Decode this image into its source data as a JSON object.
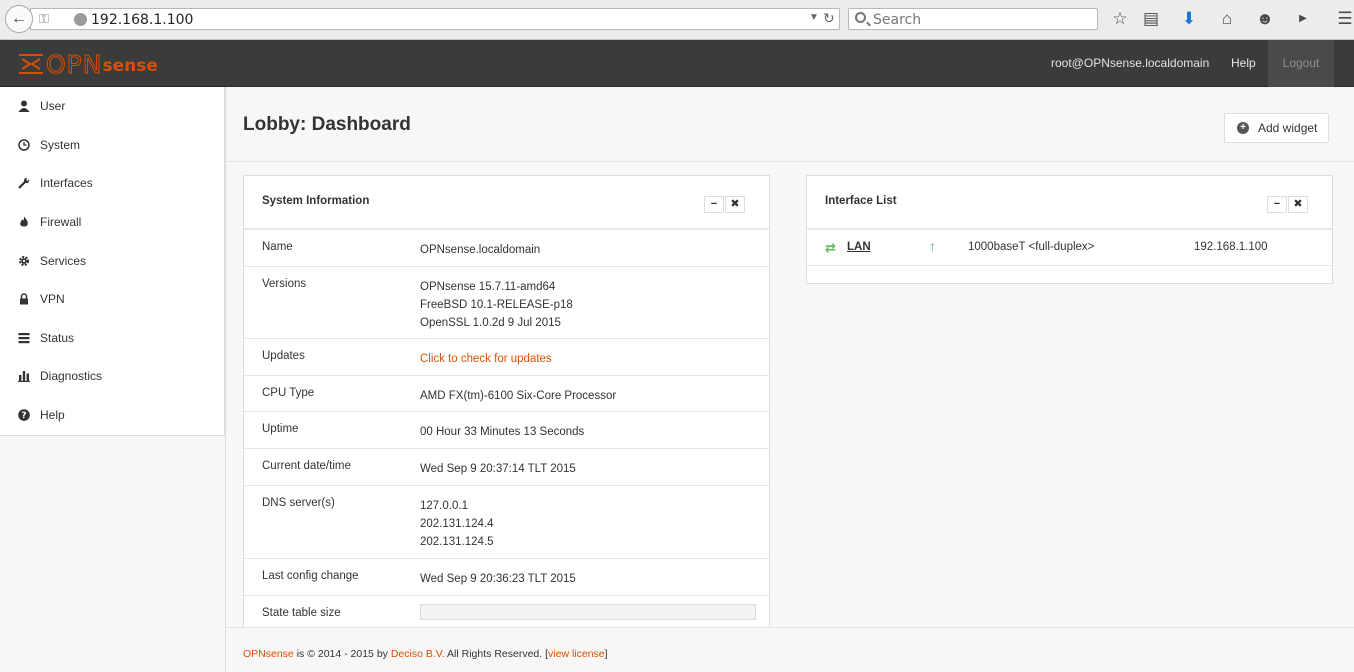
{
  "browser": {
    "url": "192.168.1.100",
    "search_placeholder": "Search"
  },
  "header": {
    "logo_left": "OPN",
    "logo_right": "sense",
    "user": "root@OPNsense.localdomain",
    "help": "Help",
    "logout": "Logout"
  },
  "sidebar": {
    "items": [
      {
        "label": "User",
        "icon": "user-icon"
      },
      {
        "label": "System",
        "icon": "system-icon"
      },
      {
        "label": "Interfaces",
        "icon": "wrench-icon"
      },
      {
        "label": "Firewall",
        "icon": "fire-icon"
      },
      {
        "label": "Services",
        "icon": "gear-icon"
      },
      {
        "label": "VPN",
        "icon": "lock-icon"
      },
      {
        "label": "Status",
        "icon": "tasks-icon"
      },
      {
        "label": "Diagnostics",
        "icon": "bar-chart-icon"
      },
      {
        "label": "Help",
        "icon": "question-icon"
      }
    ]
  },
  "page": {
    "title": "Lobby: Dashboard",
    "add_widget": "Add widget"
  },
  "system_info": {
    "title": "System Information",
    "rows": {
      "name": {
        "label": "Name",
        "value": "OPNsense.localdomain"
      },
      "versions": {
        "label": "Versions",
        "lines": [
          "OPNsense 15.7.11-amd64",
          "FreeBSD 10.1-RELEASE-p18",
          "OpenSSL 1.0.2d 9 Jul 2015"
        ]
      },
      "updates": {
        "label": "Updates",
        "value": "Click to check for updates"
      },
      "cpu": {
        "label": "CPU Type",
        "value": "AMD FX(tm)-6100 Six-Core Processor"
      },
      "uptime": {
        "label": "Uptime",
        "value": "00 Hour 33 Minutes 13 Seconds"
      },
      "datetime": {
        "label": "Current date/time",
        "value": "Wed Sep 9 20:37:14 TLT 2015"
      },
      "dns": {
        "label": "DNS server(s)",
        "lines": [
          "127.0.0.1",
          "202.131.124.4",
          "202.131.124.5"
        ]
      },
      "last_config": {
        "label": "Last config change",
        "value": "Wed Sep 9 20:36:23 TLT 2015"
      },
      "state_table": {
        "label": "State table size"
      }
    }
  },
  "interface_list": {
    "title": "Interface List",
    "interfaces": [
      {
        "name": "LAN",
        "media": "1000baseT <full-duplex>",
        "ip": "192.168.1.100",
        "status": "up"
      }
    ]
  },
  "footer": {
    "brand": "OPNsense",
    "text": " is © 2014 - 2015 by ",
    "company": "Deciso B.V.",
    "rights": " All Rights Reserved. [",
    "license": "view license",
    "close": "]"
  },
  "colors": {
    "accent": "#d94f00",
    "header_bg": "#3b3b3b",
    "status_up": "#5cb85c"
  }
}
